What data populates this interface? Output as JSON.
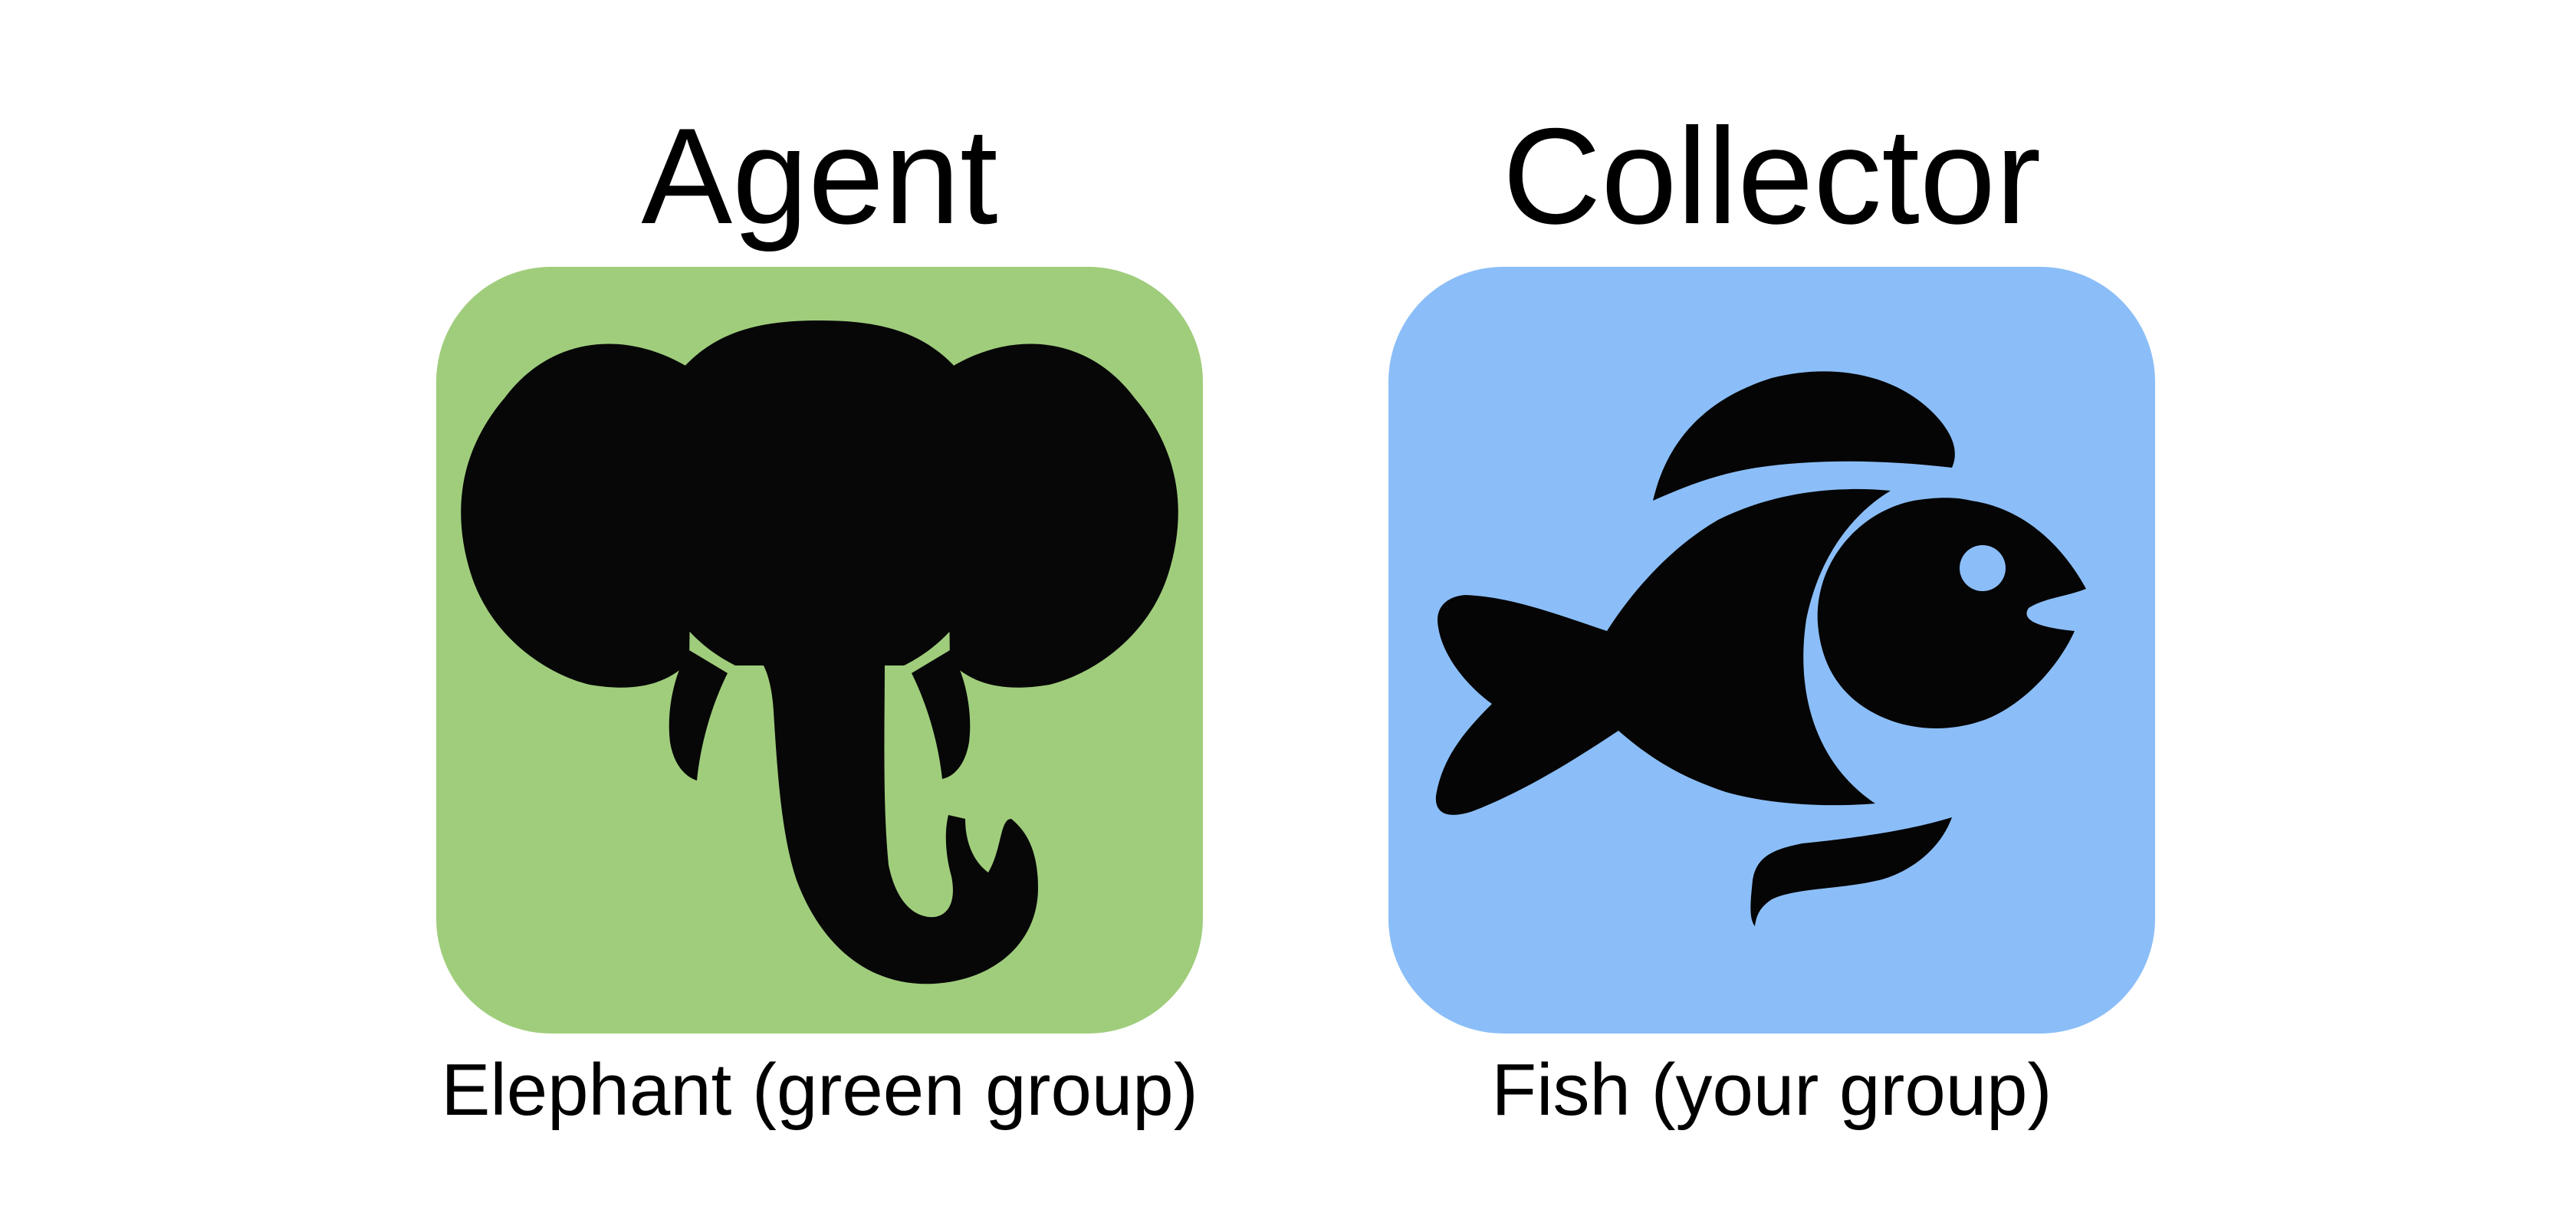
{
  "agent": {
    "title": "Agent",
    "caption": "Elephant (green group)",
    "tile_color": "#a0cd7c",
    "icon": "elephant-icon"
  },
  "collector": {
    "title": "Collector",
    "caption": "Fish (your group)",
    "tile_color": "#8bbef8",
    "icon": "fish-icon"
  }
}
